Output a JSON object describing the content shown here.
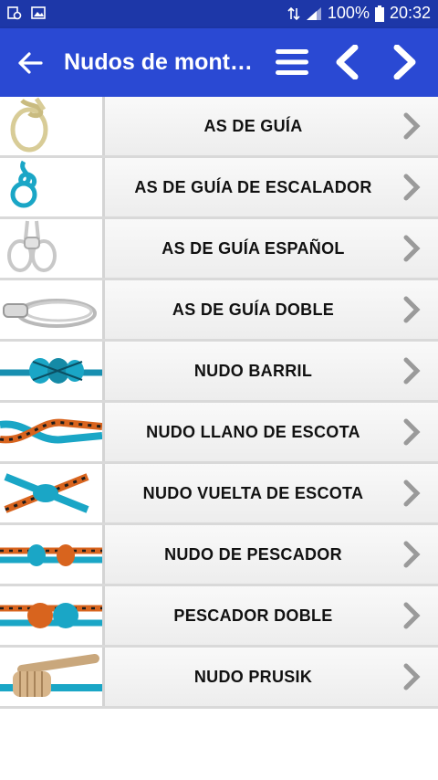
{
  "status": {
    "battery": "100%",
    "time": "20:32"
  },
  "appbar": {
    "title": "Nudos de mont…"
  },
  "colors": {
    "statusbar": "#1d37a8",
    "appbar": "#2a49d3",
    "rope_blue": "#1aa6c6",
    "rope_orange": "#d8641e"
  },
  "list": {
    "items": [
      {
        "label": "AS DE GUÍA",
        "thumb": "bowline-cream"
      },
      {
        "label": "AS DE GUÍA DE ESCALADOR",
        "thumb": "bowline-blue"
      },
      {
        "label": "AS DE GUÍA ESPAÑOL",
        "thumb": "spanish-bowline"
      },
      {
        "label": "AS DE GUÍA DOBLE",
        "thumb": "double-bowline"
      },
      {
        "label": "NUDO BARRIL",
        "thumb": "barrel-knot"
      },
      {
        "label": "NUDO LLANO DE ESCOTA",
        "thumb": "sheet-bend"
      },
      {
        "label": "NUDO VUELTA DE ESCOTA",
        "thumb": "double-sheet-bend"
      },
      {
        "label": "NUDO DE PESCADOR",
        "thumb": "fishermans-knot"
      },
      {
        "label": "PESCADOR DOBLE",
        "thumb": "double-fishermans"
      },
      {
        "label": "NUDO PRUSIK",
        "thumb": "prusik-knot"
      }
    ]
  }
}
